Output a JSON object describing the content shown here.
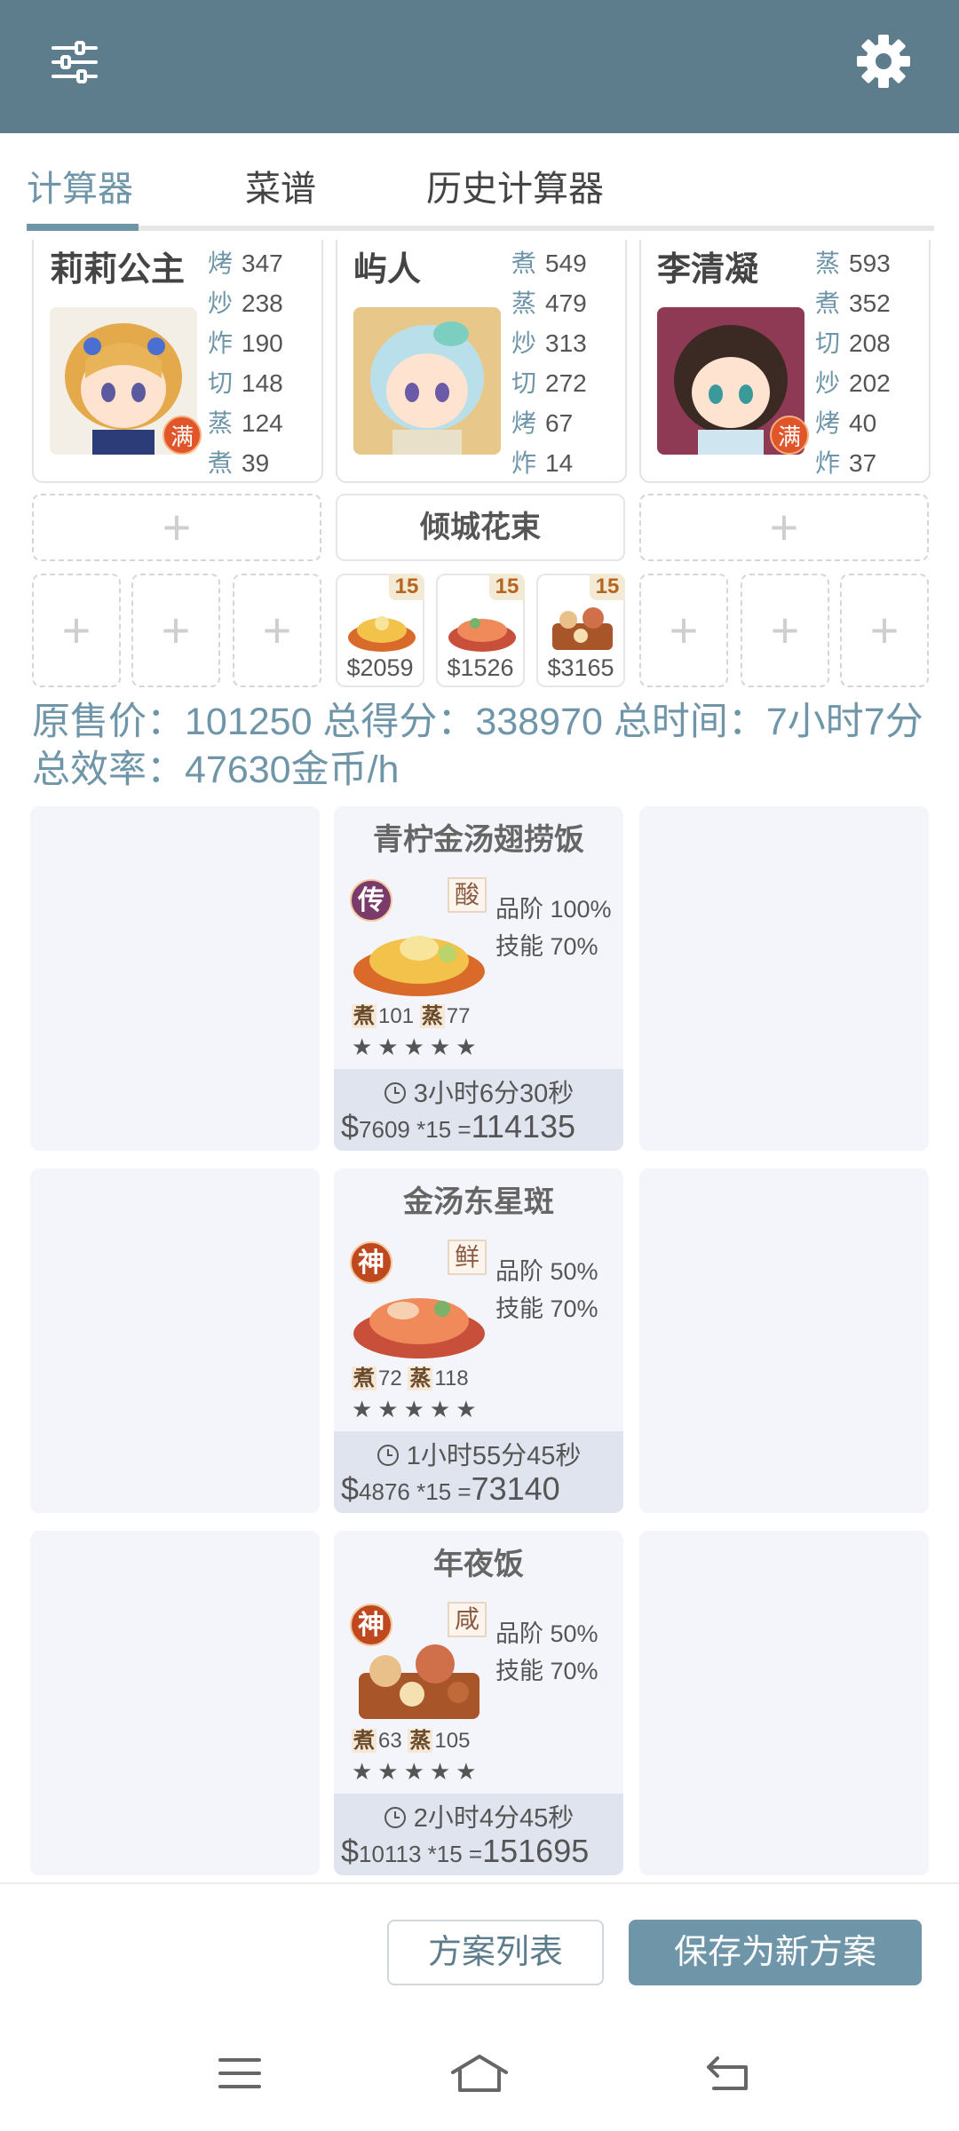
{
  "header": {
    "menu_icon": "sliders-icon",
    "settings_icon": "gear-icon",
    "color": "#5e7d8c"
  },
  "tabs": [
    {
      "label": "计算器",
      "active": true
    },
    {
      "label": "菜谱",
      "active": false
    },
    {
      "label": "历史计算器",
      "active": false
    }
  ],
  "chefs": [
    {
      "name": "莉莉公主",
      "full_badge": "满",
      "skills": [
        {
          "k": "烤",
          "v": "347"
        },
        {
          "k": "炒",
          "v": "238"
        },
        {
          "k": "炸",
          "v": "190"
        },
        {
          "k": "切",
          "v": "148"
        },
        {
          "k": "蒸",
          "v": "124"
        },
        {
          "k": "煮",
          "v": "39"
        }
      ]
    },
    {
      "name": "屿人",
      "full_badge": "",
      "skills": [
        {
          "k": "煮",
          "v": "549"
        },
        {
          "k": "蒸",
          "v": "479"
        },
        {
          "k": "炒",
          "v": "313"
        },
        {
          "k": "切",
          "v": "272"
        },
        {
          "k": "烤",
          "v": "67"
        },
        {
          "k": "炸",
          "v": "14"
        }
      ]
    },
    {
      "name": "李清凝",
      "full_badge": "满",
      "skills": [
        {
          "k": "蒸",
          "v": "593"
        },
        {
          "k": "煮",
          "v": "352"
        },
        {
          "k": "切",
          "v": "208"
        },
        {
          "k": "炒",
          "v": "202"
        },
        {
          "k": "烤",
          "v": "40"
        },
        {
          "k": "炸",
          "v": "37"
        }
      ]
    }
  ],
  "equipment": {
    "middle": "倾城花束"
  },
  "dish_slots": [
    {
      "qty": "15",
      "price": "$2059"
    },
    {
      "qty": "15",
      "price": "$1526"
    },
    {
      "qty": "15",
      "price": "$3165"
    }
  ],
  "summary": {
    "text": "原售价：101250 总得分：338970 总时间：7小时7分 总效率：47630金币/h"
  },
  "recipes": [
    {
      "title": "青柠金汤翅捞饭",
      "rarity": "传",
      "rarity_color": "#7a3a6a",
      "taste": "酸",
      "quality": "品阶 100%",
      "skill": "技能 70%",
      "req": [
        {
          "k": "煮",
          "v": "101"
        },
        {
          "k": "蒸",
          "v": "77"
        }
      ],
      "stars": "★★★★★",
      "time": "3小时6分30秒",
      "price": "7609",
      "mult": "*15",
      "eq": "=",
      "total": "114135"
    },
    {
      "title": "金汤东星斑",
      "rarity": "神",
      "rarity_color": "#c0481e",
      "taste": "鲜",
      "quality": "品阶 50%",
      "skill": "技能 70%",
      "req": [
        {
          "k": "煮",
          "v": "72"
        },
        {
          "k": "蒸",
          "v": "118"
        }
      ],
      "stars": "★★★★★",
      "time": "1小时55分45秒",
      "price": "4876",
      "mult": "*15",
      "eq": "=",
      "total": "73140"
    },
    {
      "title": "年夜饭",
      "rarity": "神",
      "rarity_color": "#c0481e",
      "taste": "咸",
      "quality": "品阶 50%",
      "skill": "技能 70%",
      "req": [
        {
          "k": "煮",
          "v": "63"
        },
        {
          "k": "蒸",
          "v": "105"
        }
      ],
      "stars": "★★★★★",
      "time": "2小时4分45秒",
      "price": "10113",
      "mult": "*15",
      "eq": "=",
      "total": "151695"
    }
  ],
  "currency_symbol": "$",
  "clock_icon": "clock-icon",
  "bottom": {
    "list_label": "方案列表",
    "save_label": "保存为新方案"
  },
  "sysnav": {
    "recents_icon": "menu-icon",
    "home_icon": "home-icon",
    "back_icon": "back-icon"
  }
}
